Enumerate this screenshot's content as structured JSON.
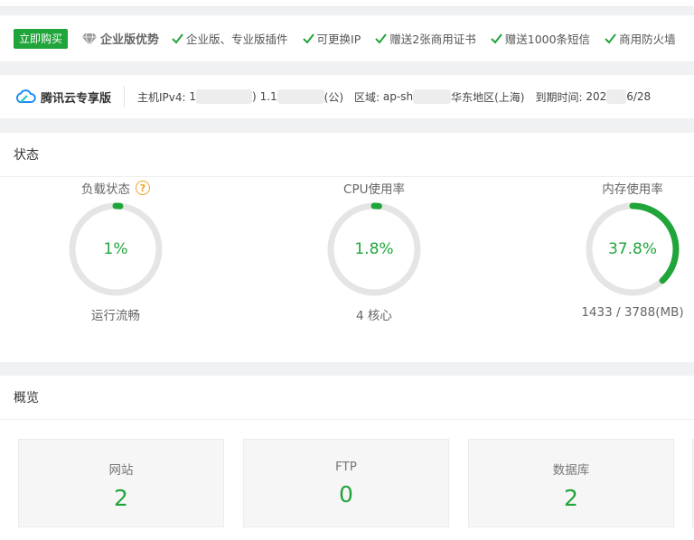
{
  "promo": {
    "buy_label": "立即购买",
    "title": "企业版优势",
    "features": [
      "企业版、专业版插件",
      "可更换IP",
      "赠送2张商用证书",
      "赠送1000条短信",
      "商用防火墙"
    ]
  },
  "host": {
    "brand": "腾讯云专享版",
    "ipv4_label": "主机IPv4:",
    "ip_private_prefix": "1",
    "ip_private_suffix": ")",
    "ip_public_prefix": "1.1",
    "ip_public_suffix": "(公)",
    "region_label": "区域:",
    "region_prefix": "ap-sh",
    "region_name": "华东地区(上海)",
    "expire_label": "到期时间:",
    "expire_prefix": "202",
    "expire_suffix": "6/28"
  },
  "status": {
    "title": "状态",
    "gauges": [
      {
        "label": "负载状态",
        "value": "1%",
        "percent": 1,
        "sub": "运行流畅",
        "help": "?"
      },
      {
        "label": "CPU使用率",
        "value": "1.8%",
        "percent": 1.8,
        "sub": "4 核心"
      },
      {
        "label": "内存使用率",
        "value": "37.8%",
        "percent": 37.8,
        "sub": "1433 / 3788(MB)"
      }
    ]
  },
  "overview": {
    "title": "概览",
    "stats": [
      {
        "label": "网站",
        "value": "2"
      },
      {
        "label": "FTP",
        "value": "0"
      },
      {
        "label": "数据库",
        "value": "2"
      }
    ]
  },
  "colors": {
    "accent": "#20a53a",
    "warning": "#f0a020",
    "track": "#e5e5e5"
  }
}
